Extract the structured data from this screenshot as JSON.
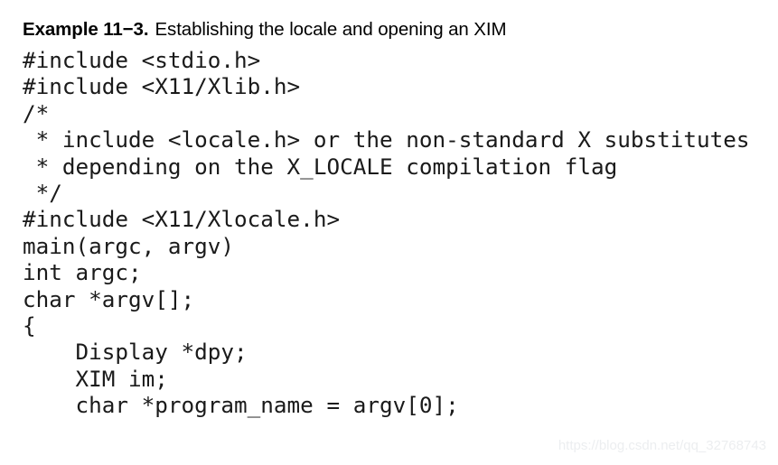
{
  "caption": {
    "label": "Example 11−3.",
    "text": "Establishing the locale and opening an XIM"
  },
  "code": {
    "language": "c",
    "lines": [
      "#include <stdio.h>",
      "#include <X11/Xlib.h>",
      "/*",
      " * include <locale.h> or the non-standard X substitutes",
      " * depending on the X_LOCALE compilation flag",
      " */",
      "#include <X11/Xlocale.h>",
      "main(argc, argv)",
      "int argc;",
      "char *argv[];",
      "{",
      "    Display *dpy;",
      "    XIM im;",
      "    char *program_name = argv[0];"
    ]
  },
  "watermark": {
    "text": "https://blog.csdn.net/qq_32768743"
  },
  "colors": {
    "background": "#ffffff",
    "text": "#000000",
    "code_text": "#1a1a1a",
    "watermark": "#eceef0"
  }
}
